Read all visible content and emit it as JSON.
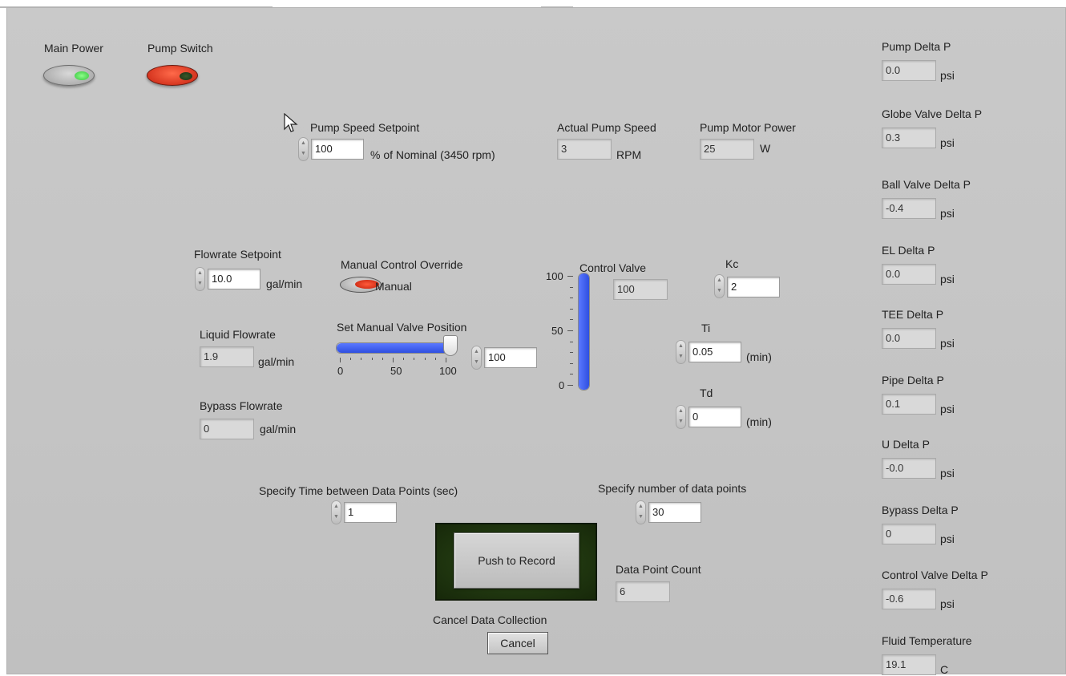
{
  "power": {
    "main_power_label": "Main Power",
    "pump_switch_label": "Pump Switch"
  },
  "pump": {
    "speed_setpoint_label": "Pump Speed Setpoint",
    "speed_setpoint_value": "100",
    "speed_setpoint_unit": "% of Nominal (3450 rpm)",
    "actual_speed_label": "Actual Pump Speed",
    "actual_speed_value": "3",
    "actual_speed_unit": "RPM",
    "motor_power_label": "Pump Motor Power",
    "motor_power_value": "25",
    "motor_power_unit": "W"
  },
  "flow": {
    "setpoint_label": "Flowrate Setpoint",
    "setpoint_value": "10.0",
    "setpoint_unit": "gal/min",
    "liquid_label": "Liquid Flowrate",
    "liquid_value": "1.9",
    "liquid_unit": "gal/min",
    "bypass_label": "Bypass Flowrate",
    "bypass_value": "0",
    "bypass_unit": "gal/min"
  },
  "manual": {
    "override_label": "Manual Control Override",
    "override_state": "Manual",
    "valve_position_label": "Set Manual Valve Position",
    "slider_value": 100,
    "slider_ticks": [
      "0",
      "50",
      "100"
    ],
    "valve_position_value": "100"
  },
  "control_valve": {
    "label": "Control Valve",
    "value": "100",
    "level": 100,
    "scale_ticks": [
      "100",
      "50",
      "0"
    ]
  },
  "pid": {
    "kc_label": "Kc",
    "kc_value": "2",
    "ti_label": "Ti",
    "ti_value": "0.05",
    "ti_unit": "(min)",
    "td_label": "Td",
    "td_value": "0",
    "td_unit": "(min)"
  },
  "data_collection": {
    "time_between_label": "Specify Time between Data Points (sec)",
    "time_between_value": "1",
    "num_points_label": "Specify number of data points",
    "num_points_value": "30",
    "record_button": "Push to Record",
    "count_label": "Data Point Count",
    "count_value": "6",
    "cancel_label": "Cancel Data Collection",
    "cancel_button": "Cancel"
  },
  "readings": [
    {
      "label": "Pump Delta P",
      "value": "0.0",
      "unit": "psi"
    },
    {
      "label": "Globe Valve Delta P",
      "value": "0.3",
      "unit": "psi"
    },
    {
      "label": "Ball Valve Delta P",
      "value": "-0.4",
      "unit": "psi"
    },
    {
      "label": "EL Delta P",
      "value": "0.0",
      "unit": "psi"
    },
    {
      "label": "TEE Delta P",
      "value": "0.0",
      "unit": "psi"
    },
    {
      "label": "Pipe Delta P",
      "value": "0.1",
      "unit": "psi"
    },
    {
      "label": "U Delta P",
      "value": "-0.0",
      "unit": "psi"
    },
    {
      "label": "Bypass Delta P",
      "value": "0",
      "unit": "psi"
    },
    {
      "label": "Control Valve Delta P",
      "value": "-0.6",
      "unit": "psi"
    },
    {
      "label": "Fluid Temperature",
      "value": "19.1",
      "unit": "C"
    }
  ],
  "colors": {
    "panel": "#c6c6c6",
    "led_on_green": "#3fd84a",
    "switch_red": "#e03a24",
    "bar_blue": "#2f4fe0",
    "record_frame": "#1f3410"
  }
}
